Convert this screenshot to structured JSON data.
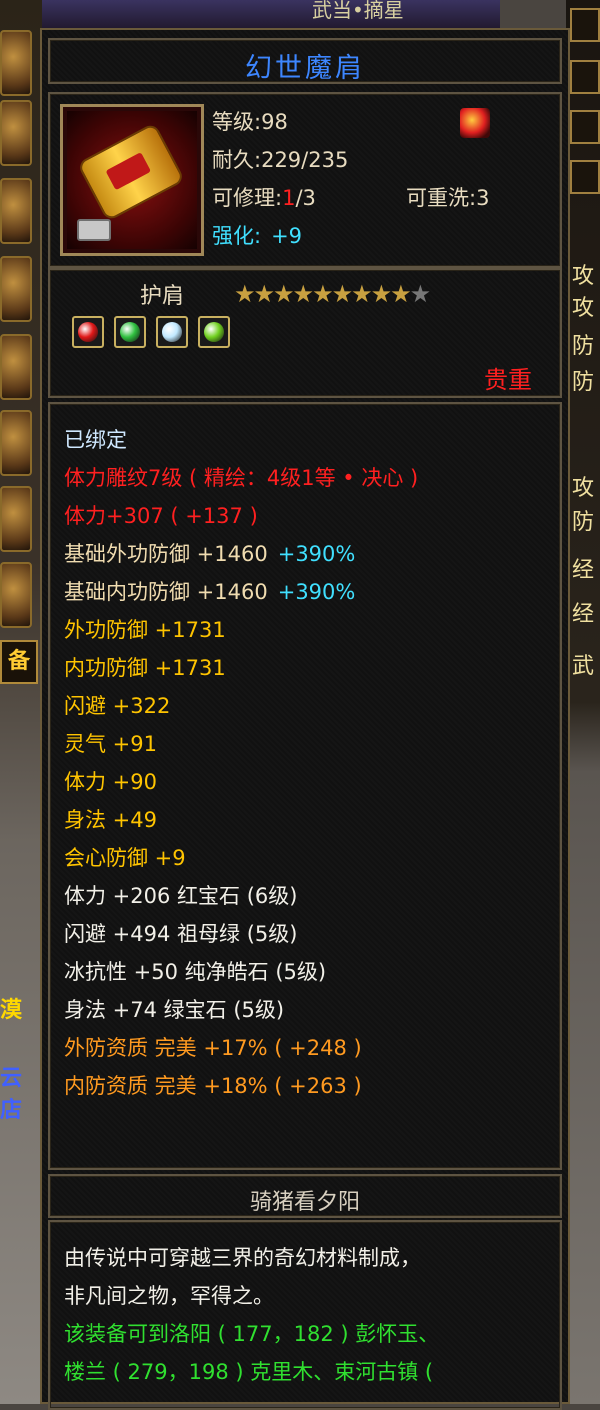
{
  "background": {
    "top_text": "武当•摘星",
    "left_tab": "备",
    "left_frag1": "漠",
    "left_frag2": "云店",
    "right_chars": [
      "攻",
      "攻",
      "防",
      "防",
      "攻",
      "防",
      "经",
      "经",
      "武"
    ]
  },
  "item": {
    "name": "幻世魔肩",
    "level_label": "等级:",
    "level": "98",
    "durability_label": "耐久:",
    "durability": "229/235",
    "repair_label": "可修理:",
    "repair_used": "1",
    "repair_max": "/3",
    "rewash_label": "可重洗:",
    "rewash": "3",
    "enhance_label": "强化:",
    "enhance": "+9",
    "slot": "护肩",
    "stars_filled": 9,
    "stars_total": 10,
    "quality": "贵重"
  },
  "gems": [
    {
      "name": "ruby-gem-icon",
      "color": "#e01818"
    },
    {
      "name": "emerald-gem-icon",
      "color": "#30c040"
    },
    {
      "name": "diamond-gem-icon",
      "color": "#c0e8ff"
    },
    {
      "name": "peridot-gem-icon",
      "color": "#70d020"
    }
  ],
  "attributes": [
    {
      "text": "已绑定",
      "color": "white"
    },
    {
      "text": "体力雕纹7级 ( 精绘：4级1等 • 决心 )",
      "color": "red"
    },
    {
      "text": "体力+307 ( +137 )",
      "color": "red"
    },
    {
      "text": "基础外功防御 +1460",
      "extra": "+390%",
      "color": "tan"
    },
    {
      "text": "基础内功防御 +1460",
      "extra": "+390%",
      "color": "tan"
    },
    {
      "text": "外功防御 +1731",
      "color": "yellow"
    },
    {
      "text": "内功防御 +1731",
      "color": "yellow"
    },
    {
      "text": "闪避 +322",
      "color": "yellow"
    },
    {
      "text": "灵气 +91",
      "color": "yellow"
    },
    {
      "text": "体力 +90",
      "color": "yellow"
    },
    {
      "text": "身法 +49",
      "color": "yellow"
    },
    {
      "text": "会心防御 +9",
      "color": "yellow"
    },
    {
      "text": "体力 +206 红宝石 (6级)",
      "color": "light"
    },
    {
      "text": "闪避 +494 祖母绿 (5级)",
      "color": "light"
    },
    {
      "text": "冰抗性 +50 纯净皓石 (5级)",
      "color": "light"
    },
    {
      "text": "身法 +74 绿宝石 (5级)",
      "color": "light"
    },
    {
      "text": "外防资质  完美 +17% ( +248 )",
      "color": "orange"
    },
    {
      "text": "内防资质  完美 +18% ( +263 )",
      "color": "orange"
    }
  ],
  "owner": "骑猪看夕阳",
  "description": [
    {
      "text": "由传说中可穿越三界的奇幻材料制成，",
      "color": "#f2f0e8"
    },
    {
      "text": "非凡间之物，罕得之。",
      "color": "#f2f0e8"
    },
    {
      "text": "该装备可到洛阳 ( 177，182 ) 彭怀玉、",
      "color": "#30e030"
    },
    {
      "text": "楼兰 ( 279，198 ) 克里木、束河古镇 (",
      "color": "#30e030"
    }
  ],
  "colors": {
    "title_blue": "#3d86ff",
    "red": "#ff2020",
    "cyan": "#40e0ff",
    "yellow": "#ffc400",
    "orange": "#ff9a20",
    "green": "#30e030"
  }
}
